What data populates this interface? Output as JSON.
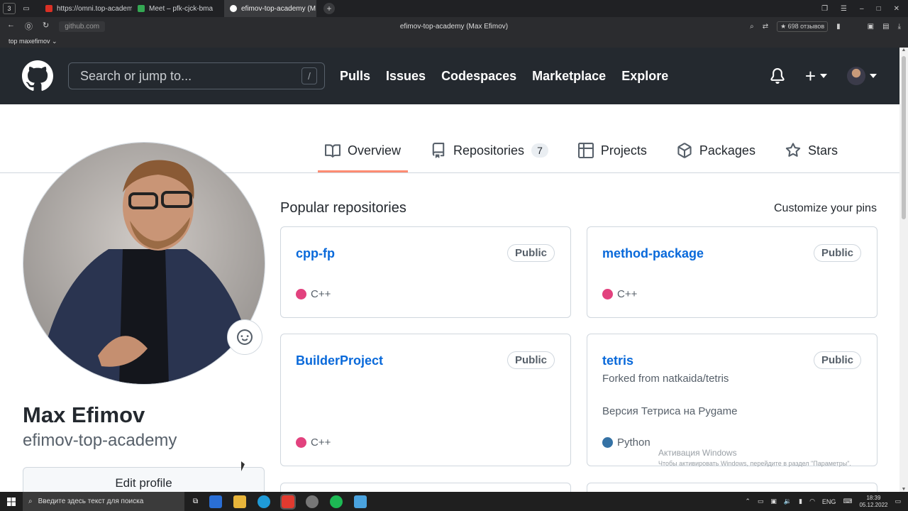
{
  "browser": {
    "tab_counter": "3",
    "tabs": [
      {
        "title": "https://omni.top-academy",
        "color": "#d93025"
      },
      {
        "title": "Meet – pfk-cjck-bma",
        "color": "#34a853"
      },
      {
        "title": "efimov-top-academy (M",
        "color": "#ffffff"
      }
    ],
    "url": "github.com",
    "page_title": "efimov-top-academy (Max Efimov)",
    "reviews": "★ 698 отзывов",
    "bookmark": "top maxefimov ⌄"
  },
  "header": {
    "search_placeholder": "Search or jump to...",
    "search_key": "/",
    "nav": [
      "Pulls",
      "Issues",
      "Codespaces",
      "Marketplace",
      "Explore"
    ],
    "plus": "+"
  },
  "profile_tabs": {
    "overview": "Overview",
    "repositories": "Repositories",
    "repo_count": "7",
    "projects": "Projects",
    "packages": "Packages",
    "stars": "Stars"
  },
  "profile": {
    "name": "Max Efimov",
    "login": "efimov-top-academy",
    "edit_button": "Edit profile"
  },
  "popular": {
    "title": "Popular repositories",
    "customize": "Customize your pins",
    "repos": [
      {
        "name": "cpp-fp",
        "visibility": "Public",
        "language": "C++",
        "lang_color": "#f34b7d"
      },
      {
        "name": "method-package",
        "visibility": "Public",
        "language": "C++",
        "lang_color": "#f34b7d"
      },
      {
        "name": "BuilderProject",
        "visibility": "Public",
        "language": "C++",
        "lang_color": "#f34b7d"
      },
      {
        "name": "tetris",
        "visibility": "Public",
        "fork": "Forked from natkaida/tetris",
        "description": "Версия Тетриса на Pygame",
        "language": "Python",
        "lang_color": "#3572A5"
      }
    ]
  },
  "windows": {
    "watermark_title": "Активация Windows",
    "watermark_sub": "Чтобы активировать Windows, перейдите в раздел \"Параметры\".",
    "search_placeholder": "Введите здесь текст для поиска",
    "lang": "ENG",
    "time": "18:39",
    "date": "05.12.2022"
  }
}
